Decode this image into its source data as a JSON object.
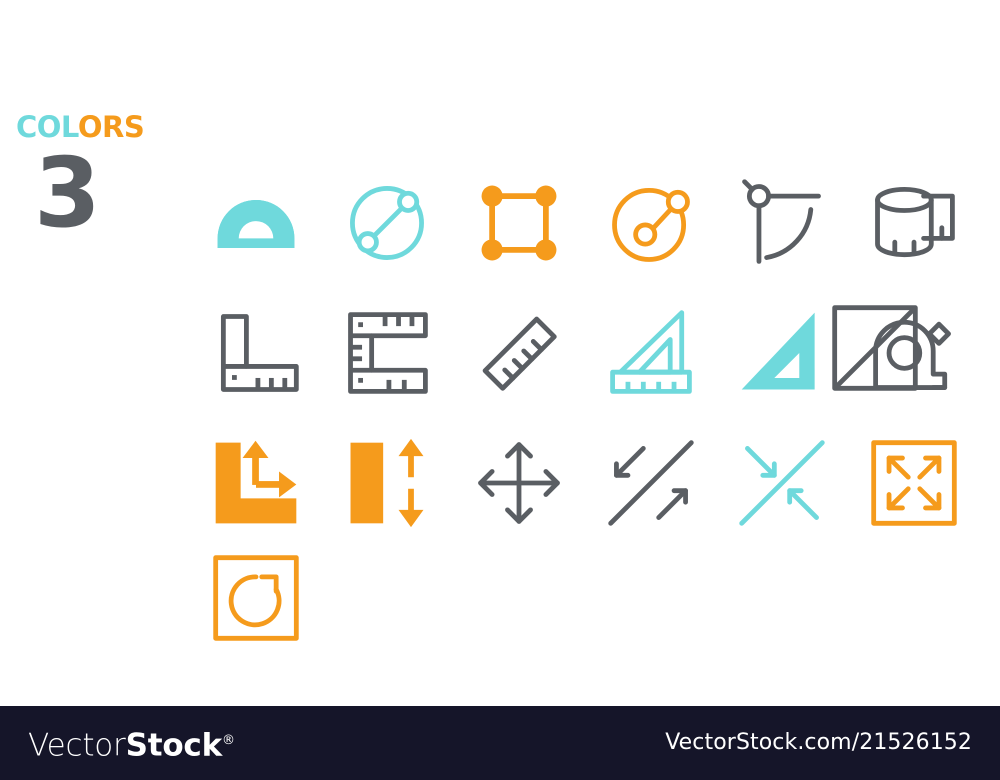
{
  "palette": {
    "background": "#ffffff",
    "turquoise": "#6FD9DC",
    "orange": "#F59B1C",
    "gray": "#5A5E63",
    "footer_background": "#151529",
    "footer_text": "#ffffff"
  },
  "badge": {
    "word_part_a": "COL",
    "word_part_b": "ORS",
    "count": "3"
  },
  "grid": {
    "columns": 6,
    "rows": 3,
    "icons": [
      {
        "name": "protractor-icon",
        "label": "Protractor",
        "color_key": "turquoise",
        "style": "filled"
      },
      {
        "name": "circle-diameter-icon",
        "label": "Circle diameter measure",
        "color_key": "turquoise",
        "style": "outline"
      },
      {
        "name": "square-nodes-icon",
        "label": "Square with corner nodes",
        "color_key": "orange",
        "style": "outline"
      },
      {
        "name": "circle-radius-icon",
        "label": "Circle radius measure",
        "color_key": "orange",
        "style": "outline"
      },
      {
        "name": "angle-compass-icon",
        "label": "Angle compass",
        "color_key": "gray",
        "style": "outline"
      },
      {
        "name": "tape-roll-icon",
        "label": "Measuring tape roll",
        "color_key": "gray",
        "style": "outline"
      },
      {
        "name": "l-square-ruler-icon",
        "label": "L square ruler",
        "color_key": "gray",
        "style": "outline"
      },
      {
        "name": "c-bracket-ruler-icon",
        "label": "C bracket ruler",
        "color_key": "gray",
        "style": "outline"
      },
      {
        "name": "diagonal-ruler-icon",
        "label": "Diagonal ruler",
        "color_key": "gray",
        "style": "outline"
      },
      {
        "name": "triangle-ruler-set-icon",
        "label": "Set square with ruler",
        "color_key": "turquoise",
        "style": "outline"
      },
      {
        "name": "set-square-icon",
        "label": "Set square triangle",
        "color_key": "turquoise",
        "style": "filled"
      },
      {
        "name": "tape-measure-icon",
        "label": "Tape measure",
        "color_key": "gray",
        "style": "outline"
      },
      {
        "name": "square-diagonal-icon",
        "label": "Square with diagonal",
        "color_key": "gray",
        "style": "outline"
      },
      {
        "name": "corner-dimensions-icon",
        "label": "Corner width height arrows",
        "color_key": "orange",
        "style": "filled"
      },
      {
        "name": "height-dimension-icon",
        "label": "Vertical bar height arrow",
        "color_key": "orange",
        "style": "filled"
      },
      {
        "name": "move-four-arrows-icon",
        "label": "Move four directional arrows",
        "color_key": "gray",
        "style": "outline"
      },
      {
        "name": "expand-diagonal-icon",
        "label": "Expand diagonal arrows",
        "color_key": "gray",
        "style": "outline"
      },
      {
        "name": "collapse-diagonal-icon",
        "label": "Collapse diagonal arrows",
        "color_key": "turquoise",
        "style": "outline"
      },
      {
        "name": "fullscreen-expand-icon",
        "label": "Fullscreen expand square",
        "color_key": "orange",
        "style": "outline"
      },
      {
        "name": "rotate-square-icon",
        "label": "Rotate inside square",
        "color_key": "orange",
        "style": "outline"
      }
    ]
  },
  "footer": {
    "logo_light": "Vector",
    "logo_bold": "Stock",
    "logo_registered": "®",
    "url": "VectorStock.com/21526152"
  }
}
